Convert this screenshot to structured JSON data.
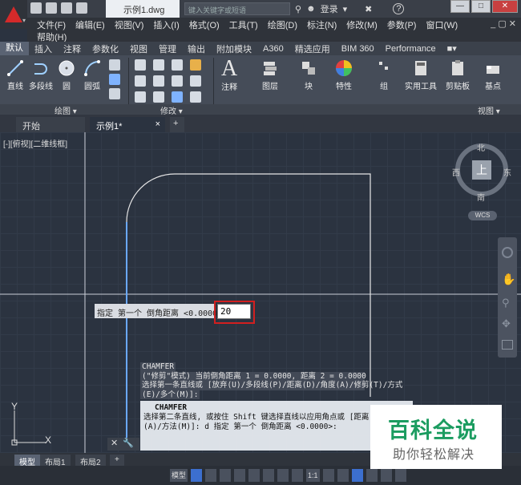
{
  "title_bar": {
    "document_tab": "示例1.dwg",
    "search_placeholder": "键入关键字或短语",
    "login_label": "登录",
    "help_label": "?",
    "window_buttons": [
      "—",
      "□",
      "✕"
    ]
  },
  "menu": {
    "items": [
      "文件(F)",
      "编辑(E)",
      "视图(V)",
      "插入(I)",
      "格式(O)",
      "工具(T)",
      "绘图(D)",
      "标注(N)",
      "修改(M)",
      "参数(P)",
      "窗口(W)"
    ],
    "second_row": [
      "帮助(H)"
    ],
    "right_controls": "_ ▢ ✕"
  },
  "ribbon_tabs": [
    "默认",
    "插入",
    "注释",
    "参数化",
    "视图",
    "管理",
    "输出",
    "附加模块",
    "A360",
    "精选应用",
    "BIM 360",
    "Performance"
  ],
  "ribbon": {
    "draw_tools": [
      "直线",
      "多段线",
      "圆",
      "圆弧"
    ],
    "large_tools": [
      "注释",
      "图层",
      "块",
      "特性",
      "组",
      "实用工具",
      "剪贴板",
      "基点"
    ],
    "panel_labels": [
      "绘图 ▾",
      "修改 ▾",
      "视图 ▾"
    ]
  },
  "file_tabs": {
    "start": "开始",
    "active": "示例1*",
    "close": "×",
    "plus": "+"
  },
  "viewport_label": "[-][俯视][二维线框]",
  "viewcube": {
    "face": "上",
    "north": "北",
    "south": "南",
    "east": "东",
    "west": "西",
    "wcs": "WCS"
  },
  "dynamic_input": {
    "prompt": "指定 第一个 倒角距离 <0.0000>:",
    "value": "20"
  },
  "command_history": [
    "CHAMFER",
    "(\"修剪\"模式) 当前倒角距离 1 = 0.0000, 距离 2 = 0.0000",
    "选择第一条直线或 [放弃(U)/多段线(P)/距离(D)/角度(A)/修剪(T)/方式",
    "(E)/多个(M)]:"
  ],
  "command_line": {
    "title": "CHAMFER",
    "line1": "选择第二条直线, 或按住 Shift 键选择直线以应用角点或 [距离",
    "line2": "(A)/方法(M)]: d 指定 第一个 倒角距离 <0.0000>:"
  },
  "ucs": {
    "x": "X",
    "y": "Y"
  },
  "layout_tabs": [
    "模型",
    "布局1",
    "布局2",
    "+"
  ],
  "status_bar": {
    "model_label": "模型",
    "scale": "1:1"
  },
  "watermark": {
    "title": "百科全说",
    "subtitle": "助你轻松解决"
  },
  "colors": {
    "accent_red": "#d21f1f",
    "app_red": "#d42a2a",
    "canvas_bg": "#2b3340",
    "watermark_green": "#1b9c60"
  }
}
